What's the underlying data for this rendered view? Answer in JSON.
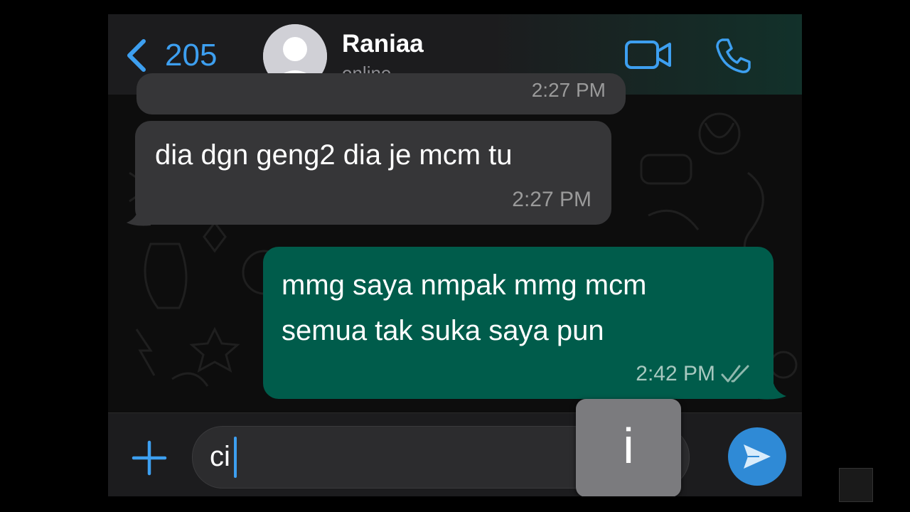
{
  "header": {
    "back_count": "205",
    "contact_name": "Raniaa",
    "contact_status": "online"
  },
  "messages": [
    {
      "direction": "incoming",
      "text": "",
      "time": "2:27 PM"
    },
    {
      "direction": "incoming",
      "text": "dia dgn geng2 dia je mcm tu",
      "time": "2:27 PM"
    },
    {
      "direction": "outgoing",
      "text": "mmg saya nmpak mmg mcm semua tak suka saya pun",
      "line1": "mmg saya nmpak mmg mcm",
      "line2": "semua tak suka saya pun",
      "time": "2:42 PM",
      "status": "read-ticks"
    }
  ],
  "composer": {
    "typed_text": "ci",
    "key_preview": "i"
  },
  "colors": {
    "accent": "#3d9ff0",
    "incoming_bubble": "#363638",
    "outgoing_bubble": "#005c4b",
    "send_button": "#2f8ad6"
  },
  "icons": [
    "back-chevron-icon",
    "avatar-placeholder-icon",
    "video-call-icon",
    "phone-call-icon",
    "plus-icon",
    "send-icon",
    "double-check-icon"
  ]
}
